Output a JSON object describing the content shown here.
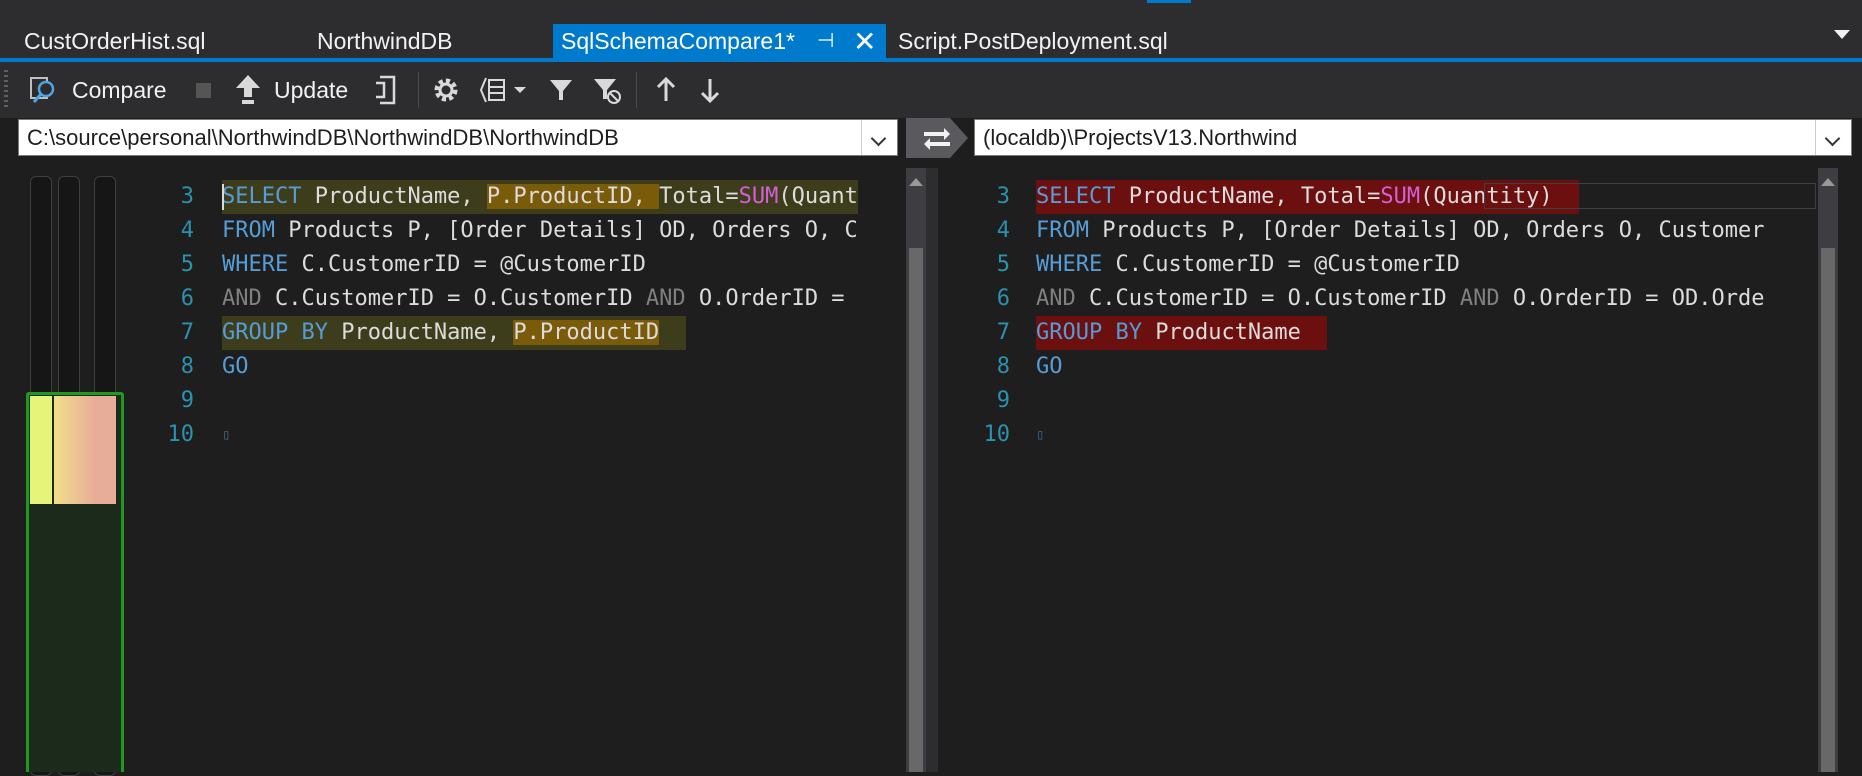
{
  "tabs": [
    {
      "label": "CustOrderHist.sql"
    },
    {
      "label": "NorthwindDB"
    },
    {
      "label": "SqlSchemaCompare1*",
      "active": true
    },
    {
      "label": "Script.PostDeployment.sql"
    }
  ],
  "toolbar": {
    "compare_label": "Compare",
    "update_label": "Update"
  },
  "source_path": "C:\\source\\personal\\NorthwindDB\\NorthwindDB\\NorthwindDB",
  "target_path": "(localdb)\\ProjectsV13.Northwind",
  "left_editor": {
    "line_numbers": [
      "3",
      "4",
      "5",
      "6",
      "7",
      "8",
      "9",
      "10"
    ],
    "l3": {
      "a": "SELECT",
      "b": " ProductName, ",
      "c": "P.ProductID, ",
      "d": "Total=",
      "e": "SUM",
      "f": "(Quant"
    },
    "l4": {
      "a": "FROM",
      "b": " Products P, [Order Details] OD, Orders O, C"
    },
    "l5": {
      "a": "WHERE",
      "b": " C.CustomerID = @CustomerID"
    },
    "l6": {
      "a": "AND",
      "b": " C.CustomerID = O.CustomerID ",
      "c": "AND",
      "d": " O.OrderID ="
    },
    "l7": {
      "a": "GROUP BY",
      "b": " ProductName, ",
      "c": "P.ProductID"
    },
    "l8": {
      "a": "GO"
    }
  },
  "right_editor": {
    "line_numbers": [
      "3",
      "4",
      "5",
      "6",
      "7",
      "8",
      "9",
      "10"
    ],
    "l3": {
      "a": "SELECT",
      "b": " ProductName, Total=",
      "e": "SUM",
      "f": "(Quantity)"
    },
    "l4": {
      "a": "FROM",
      "b": " Products P, [Order Details] OD, Orders O, Customer"
    },
    "l5": {
      "a": "WHERE",
      "b": " C.CustomerID = @CustomerID"
    },
    "l6": {
      "a": "AND",
      "b": " C.CustomerID = O.CustomerID ",
      "c": "AND",
      "d": " O.OrderID = OD.Orde"
    },
    "l7": {
      "a": "GROUP BY",
      "b": " ProductName"
    },
    "l8": {
      "a": "GO"
    }
  },
  "colors": {
    "accent": "#007acc",
    "modified_highlight": "#7a5b0a",
    "deleted_highlight": "#6b0f0f",
    "overview_frame": "#1f9a1f",
    "overview_left": "#e6f47a",
    "overview_right": "#e8ad98"
  }
}
